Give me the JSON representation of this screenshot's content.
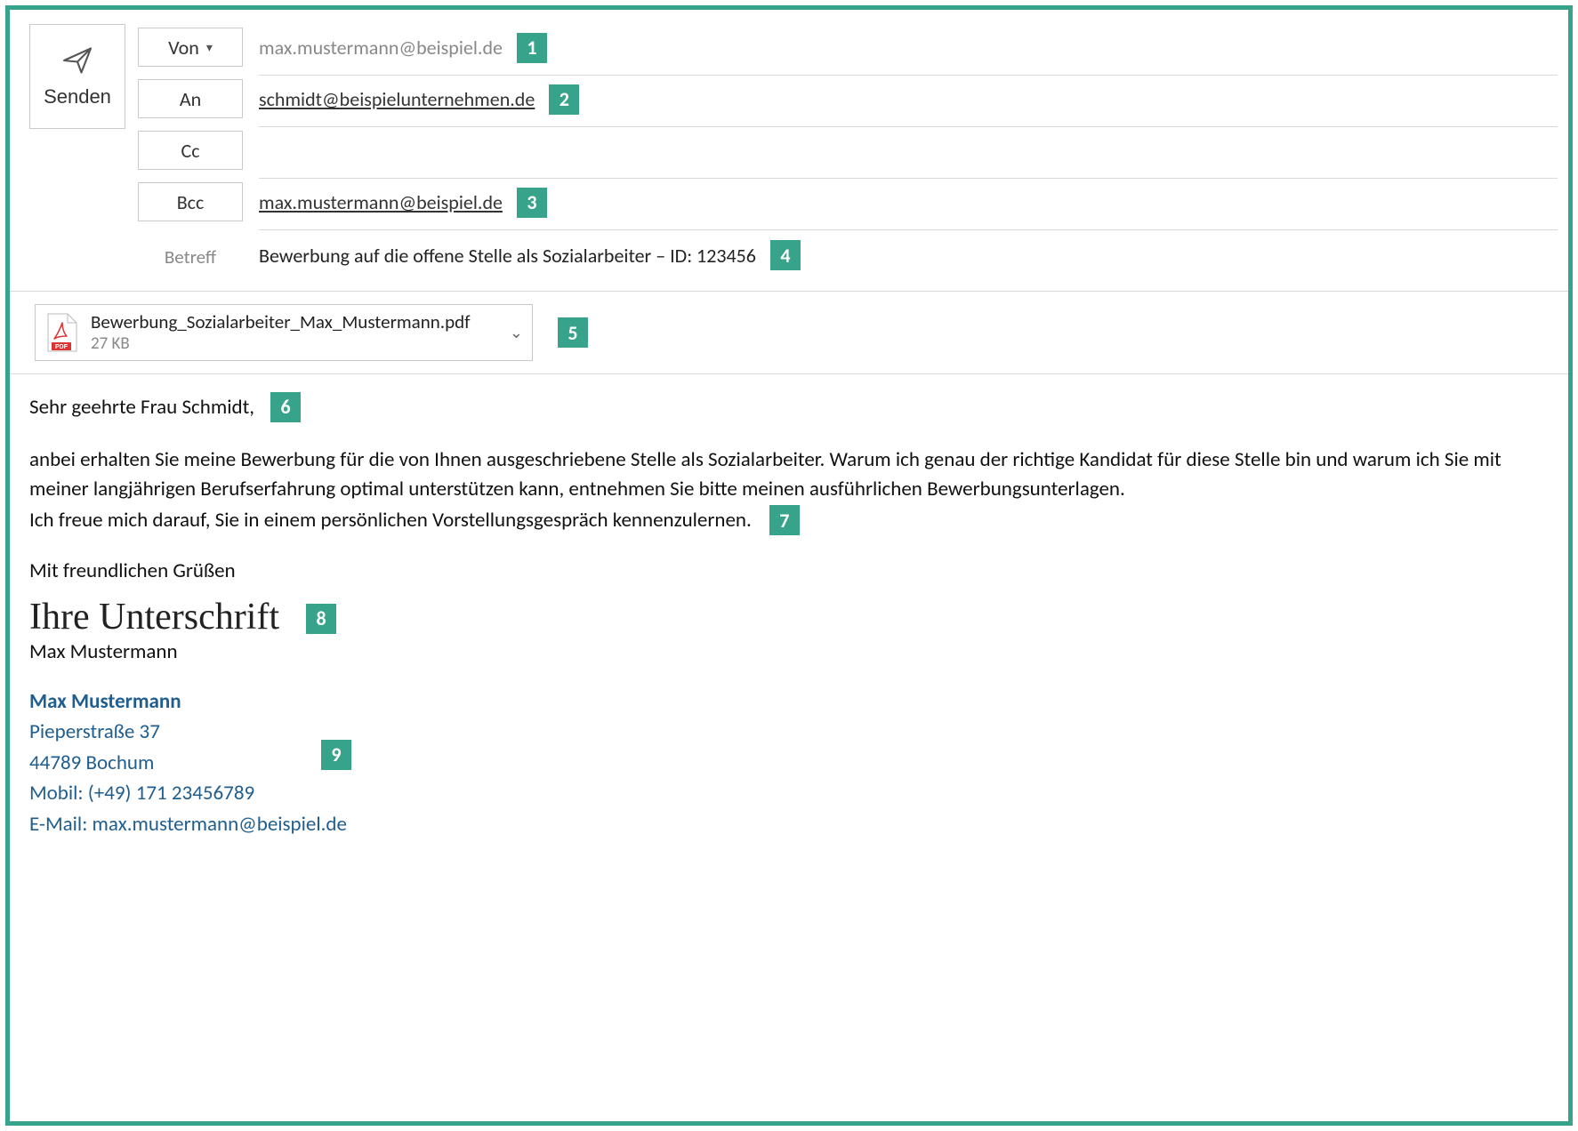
{
  "send_label": "Senden",
  "fields": {
    "from_label": "Von",
    "from_value": "max.mustermann@beispiel.de",
    "to_label": "An",
    "to_value": "schmidt@beispielunternehmen.de",
    "cc_label": "Cc",
    "cc_value": "",
    "bcc_label": "Bcc",
    "bcc_value": "max.mustermann@beispiel.de",
    "subject_label": "Betreff",
    "subject_value": "Bewerbung auf die offene Stelle als Sozialarbeiter – ID: 123456"
  },
  "attachment": {
    "name": "Bewerbung_Sozialarbeiter_Max_Mustermann.pdf",
    "size": "27 KB"
  },
  "body": {
    "salutation": "Sehr geehrte Frau Schmidt,",
    "paragraph1": "anbei erhalten Sie meine Bewerbung für die von Ihnen ausgeschriebene Stelle als Sozialarbeiter. Warum ich genau der richtige Kandidat für diese Stelle bin und warum ich Sie mit meiner langjährigen Berufserfahrung optimal unterstützen kann, entnehmen Sie bitte meinen ausführlichen Bewerbungsunterlagen.",
    "paragraph2": "Ich freue mich darauf, Sie in einem persönlichen Vorstellungsgespräch kennenzulernen.",
    "closing": "Mit freundlichen Grüßen",
    "signature_script": "Ihre Unterschrift",
    "printed_name": "Max Mustermann"
  },
  "contact": {
    "name": "Max Mustermann",
    "street": "Pieperstraße 37",
    "city": "44789 Bochum",
    "mobile": "Mobil: (+49) 171 23456789",
    "email": "E-Mail: max.mustermann@beispiel.de"
  },
  "callouts": {
    "c1": "1",
    "c2": "2",
    "c3": "3",
    "c4": "4",
    "c5": "5",
    "c6": "6",
    "c7": "7",
    "c8": "8",
    "c9": "9"
  }
}
